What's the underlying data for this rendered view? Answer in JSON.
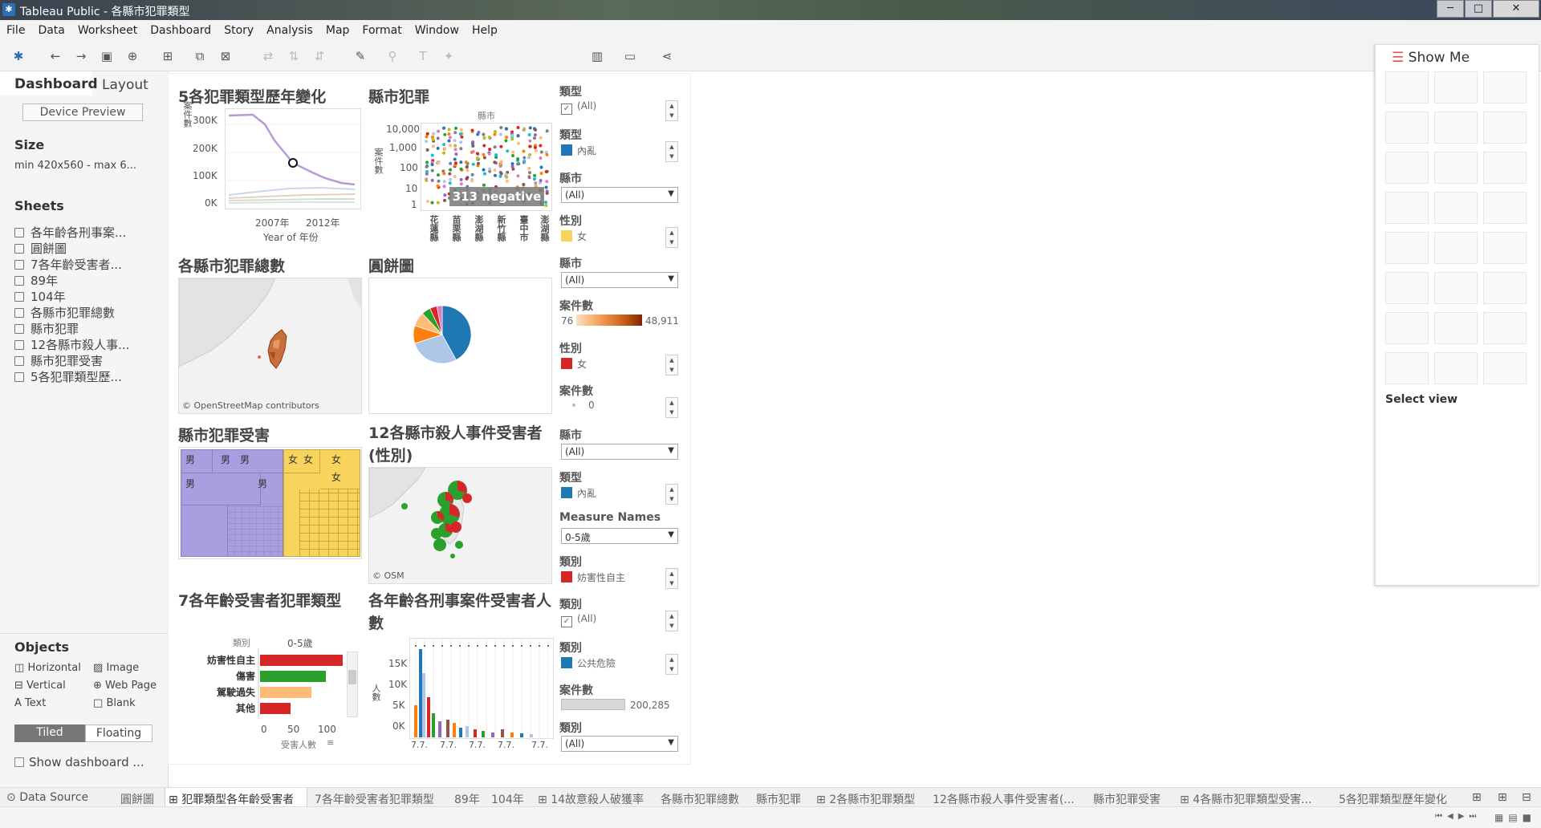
{
  "window": {
    "title": "Tableau Public - 各縣市犯罪類型",
    "min": "─",
    "max": "□",
    "close": "✕"
  },
  "menu": [
    "File",
    "Data",
    "Worksheet",
    "Dashboard",
    "Story",
    "Analysis",
    "Map",
    "Format",
    "Window",
    "Help"
  ],
  "leftpane": {
    "tab_dashboard": "Dashboard",
    "tab_layout": "Layout",
    "device_preview": "Device Preview",
    "size_heading": "Size",
    "size_value": "min 420x560 - max 6...",
    "sheets_heading": "Sheets",
    "sheets": [
      "各年齡各刑事案...",
      "圓餅圖",
      "7各年齡受害者...",
      "89年",
      "104年",
      "各縣市犯罪總數",
      "縣市犯罪",
      "12各縣市殺人事...",
      "縣市犯罪受害",
      "5各犯罪類型歷..."
    ],
    "objects_heading": "Objects",
    "objects": [
      "Horizontal",
      "Image",
      "Vertical",
      "Web Page",
      "Text",
      "Blank"
    ],
    "tiled": "Tiled",
    "floating": "Floating",
    "show_title": "Show dashboard ..."
  },
  "views": {
    "v1": {
      "title": "5各犯罪類型歷年變化",
      "yticks": [
        "300K",
        "200K",
        "100K",
        "0K"
      ],
      "xticks": [
        "2007年",
        "2012年"
      ],
      "xlabel": "Year of 年份",
      "ylabel": "案件數"
    },
    "v2": {
      "title": "縣市犯罪",
      "header": "縣市",
      "yticks": [
        "10,000",
        "1,000",
        "100",
        "10",
        "1"
      ],
      "ylabel": "案件數",
      "badge": "313 negative",
      "xcats": [
        "花蓮縣",
        "苗栗縣",
        "澎湖縣",
        "新竹縣",
        "臺中市",
        "澎湖縣"
      ]
    },
    "v3": {
      "title": "各縣市犯罪總數",
      "credit": "© OpenStreetMap contributors"
    },
    "v4": {
      "title": "圓餅圖"
    },
    "v5": {
      "title": "縣市犯罪受害",
      "male": "男",
      "female": "女"
    },
    "v6": {
      "title": "12各縣市殺人事件受害者(性別)",
      "credit": "© OSM"
    },
    "v7": {
      "title": "7各年齡受害者犯罪類型",
      "col_header": "類別",
      "age": "0-5歲",
      "rows": [
        "妨害性自主",
        "傷害",
        "駕駛過失",
        "其他"
      ],
      "xticks": [
        "0",
        "50",
        "100"
      ],
      "xlabel": "受害人數"
    },
    "v8": {
      "title": "各年齡各刑事案件受害者人數",
      "yticks": [
        "15K",
        "10K",
        "5K",
        "0K"
      ],
      "ylabel": "人數",
      "xtick": "7.7."
    }
  },
  "filters": [
    {
      "label": "類型",
      "kind": "check",
      "value": "(All)"
    },
    {
      "label": "類型",
      "kind": "legend",
      "value": "內亂"
    },
    {
      "label": "縣市",
      "kind": "dropdown",
      "value": "(All)"
    },
    {
      "label": "性別",
      "kind": "legend",
      "value": "女"
    },
    {
      "label": "縣市",
      "kind": "dropdown",
      "value": "(All)"
    },
    {
      "label": "案件數",
      "kind": "ramp",
      "min": "76",
      "max": "48,911"
    },
    {
      "label": "性別",
      "kind": "legend",
      "value": "女"
    },
    {
      "label": "案件數",
      "kind": "size",
      "value": "0"
    },
    {
      "label": "縣市",
      "kind": "dropdown",
      "value": "(All)"
    },
    {
      "label": "類型",
      "kind": "legend",
      "value": "內亂"
    },
    {
      "label": "Measure Names",
      "kind": "dropdown",
      "value": "0-5歲"
    },
    {
      "label": "類別",
      "kind": "legend",
      "value": "妨害性自主"
    },
    {
      "label": "類別",
      "kind": "check",
      "value": "(All)"
    },
    {
      "label": "類別",
      "kind": "legend",
      "value": "公共危險"
    },
    {
      "label": "案件數",
      "kind": "bar",
      "value": "200,285"
    },
    {
      "label": "類別",
      "kind": "dropdown",
      "value": "(All)"
    }
  ],
  "showme": {
    "title": "Show Me",
    "select": "Select view"
  },
  "tabs": [
    "Data Source",
    "圓餅圖",
    "犯罪類型各年齡受害者",
    "7各年齡受害者犯罪類型",
    "89年",
    "104年",
    "14故意殺人破獲率",
    "各縣市犯罪總數",
    "縣市犯罪",
    "2各縣市犯罪類型",
    "12各縣市殺人事件受害者(...",
    "縣市犯罪受害",
    "4各縣市犯罪類型受害...",
    "5各犯罪類型歷年變化"
  ],
  "colors": {
    "accent": "#1f77b4",
    "red": "#d62728",
    "green": "#2ca02c",
    "orange": "#ff7f0e",
    "purple": "#a99ee0",
    "yellow": "#f9d45c",
    "lightblue": "#aec7e8"
  }
}
